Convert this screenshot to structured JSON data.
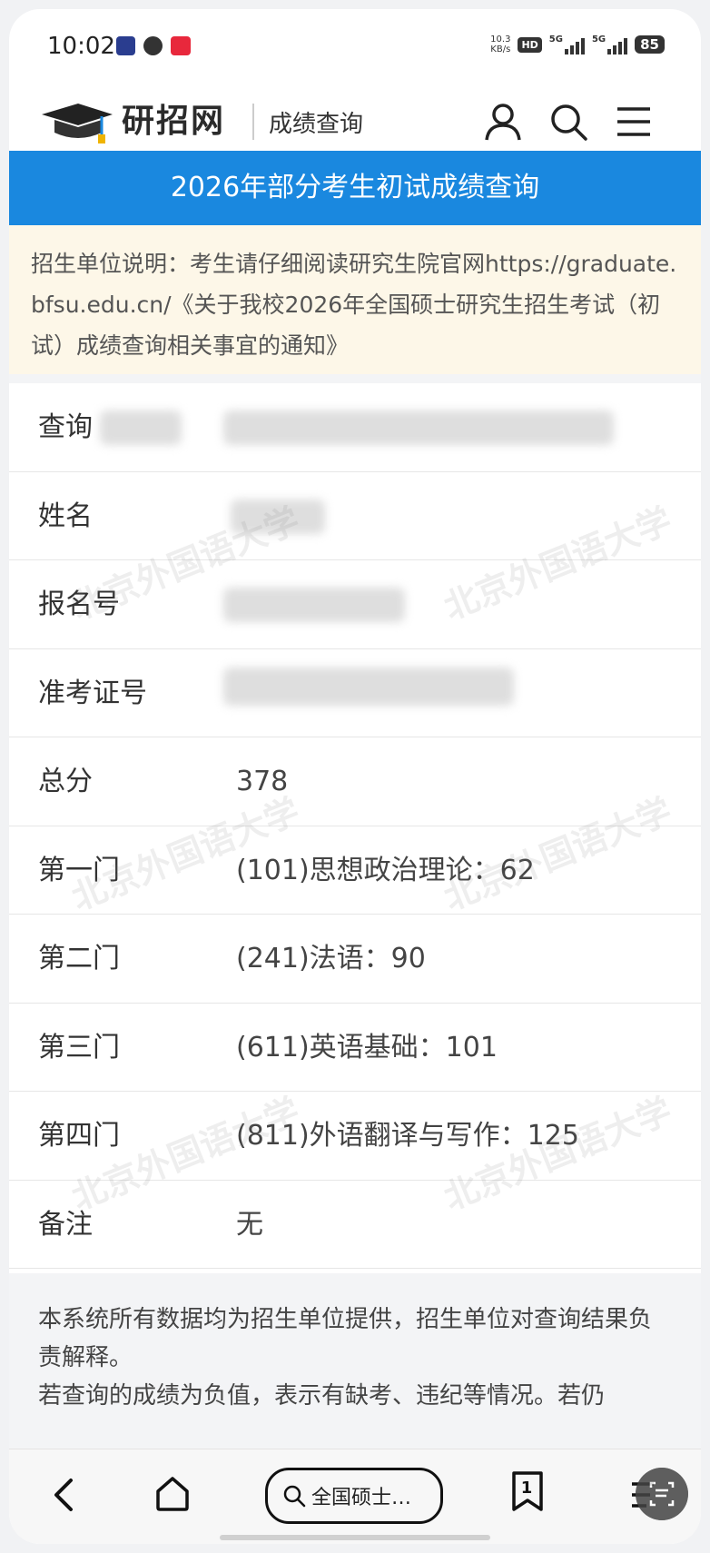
{
  "status_bar": {
    "time": "10:02",
    "network_speed_value": "10.3",
    "network_speed_unit": "KB/s",
    "hd_label": "HD",
    "sim1_label": "5G",
    "sim2_label": "5G",
    "battery": "85"
  },
  "header": {
    "logo_text": "研招网",
    "section_title": "成绩查询",
    "icons": [
      "user-icon",
      "search-icon",
      "menu-icon"
    ]
  },
  "banner": {
    "title": "2026年部分考生初试成绩查询"
  },
  "notice": {
    "text": "招生单位说明：考生请仔细阅读研究生院官网https://graduate.bfsu.edu.cn/《关于我校2026年全国硕士研究生招生考试（初试）成绩查询相关事宜的通知》"
  },
  "watermark_text": "北京外国语大学",
  "results": {
    "rows": [
      {
        "label": "查询",
        "value": ""
      },
      {
        "label": "姓名",
        "value": ""
      },
      {
        "label": "报名号",
        "value": ""
      },
      {
        "label": "准考证号",
        "value": ""
      },
      {
        "label": "总分",
        "value": "378"
      },
      {
        "label": "第一门",
        "value": "(101)思想政治理论：62"
      },
      {
        "label": "第二门",
        "value": "(241)法语：90"
      },
      {
        "label": "第三门",
        "value": "(611)英语基础：101"
      },
      {
        "label": "第四门",
        "value": "(811)外语翻译与写作：125"
      },
      {
        "label": "备注",
        "value": "无"
      }
    ]
  },
  "footnote": {
    "line1": "本系统所有数据均为招生单位提供，招生单位对查询结果负责解释。",
    "line2": "若查询的成绩为负值，表示有缺考、违纪等情况。若仍"
  },
  "bottom_bar": {
    "search_text": "全国硕士…",
    "tab_count": "1"
  },
  "colors": {
    "banner_blue": "#1a88df",
    "notice_bg": "#fdf7e8"
  }
}
